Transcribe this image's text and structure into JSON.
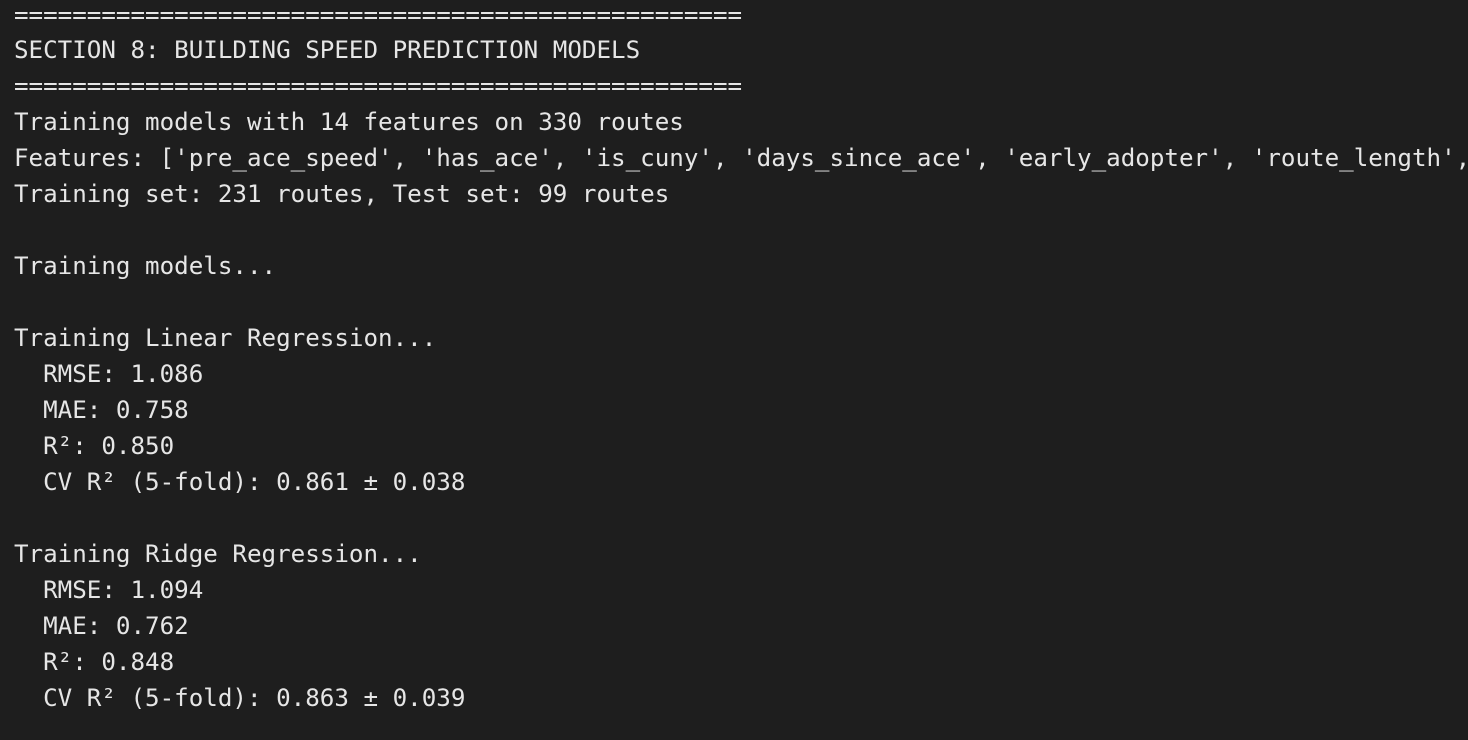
{
  "terminal": {
    "lines": [
      "==================================================",
      "SECTION 8: BUILDING SPEED PREDICTION MODELS",
      "==================================================",
      "Training models with 14 features on 330 routes",
      "Features: ['pre_ace_speed', 'has_ace', 'is_cuny', 'days_since_ace', 'early_adopter', 'route_length',",
      "Training set: 231 routes, Test set: 99 routes",
      "",
      "Training models...",
      "",
      "Training Linear Regression...",
      "  RMSE: 1.086",
      "  MAE: 0.758",
      "  R²: 0.850",
      "  CV R² (5-fold): 0.861 ± 0.038",
      "",
      "Training Ridge Regression...",
      "  RMSE: 1.094",
      "  MAE: 0.762",
      "  R²: 0.848",
      "  CV R² (5-fold): 0.863 ± 0.039"
    ]
  }
}
